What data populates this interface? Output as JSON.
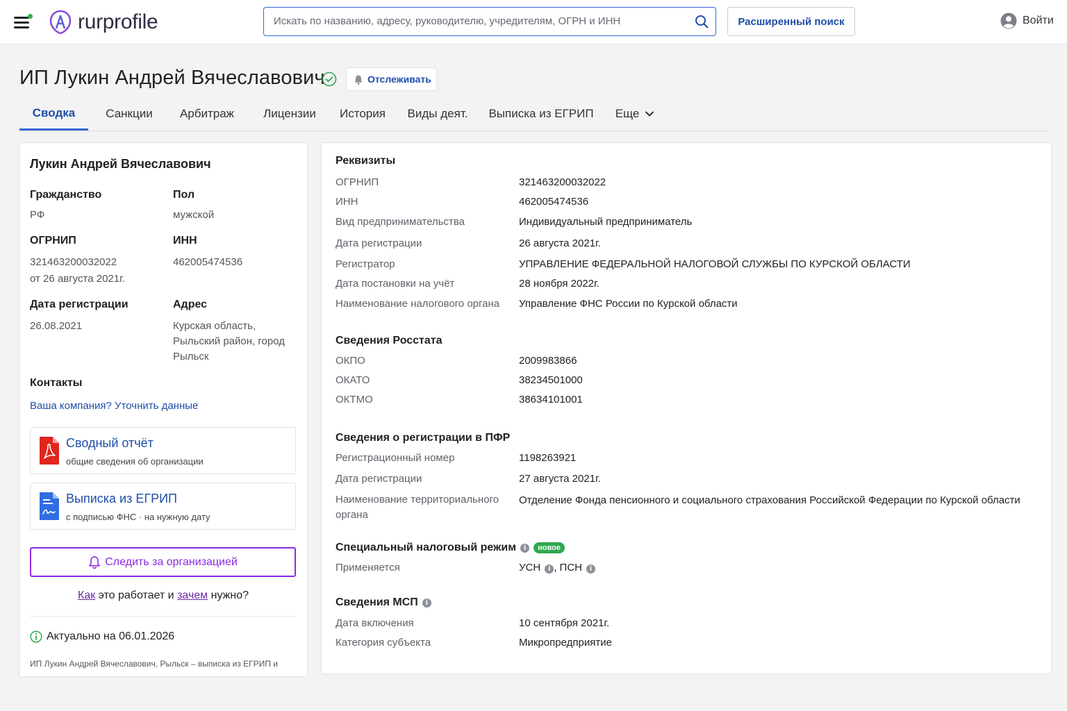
{
  "header": {
    "logo_text": "rurprofile",
    "search_placeholder": "Искать по названию, адресу, руководителю, учредителям, ОГРН и ИНН",
    "advanced_search": "Расширенный поиск",
    "login": "Войти"
  },
  "title": {
    "name": "ИП Лукин Андрей Вячеславович",
    "follow": "Отслеживать"
  },
  "tabs": [
    {
      "label": "Сводка",
      "active": true
    },
    {
      "label": "Санкции"
    },
    {
      "label": "Арбитраж"
    },
    {
      "label": "Лицензии"
    },
    {
      "label": "История"
    },
    {
      "label": "Виды деят."
    },
    {
      "label": "Выписка из ЕГРИП"
    },
    {
      "label": "Еще"
    }
  ],
  "summary": {
    "person_name": "Лукин Андрей Вячеславович",
    "citizenship_label": "Гражданство",
    "citizenship_value": "РФ",
    "sex_label": "Пол",
    "sex_value": "мужской",
    "ogrnip_label": "ОГРНИП",
    "ogrnip_value": "321463200032022",
    "ogrnip_date": "от 26 августа 2021г.",
    "inn_label": "ИНН",
    "inn_value": "462005474536",
    "reg_date_label": "Дата регистрации",
    "reg_date_value": "26.08.2021",
    "address_label": "Адрес",
    "address_value": [
      "Курская область,",
      "Рыльский район, город",
      "Рыльск"
    ],
    "contacts_label": "Контакты",
    "contacts_link": "Ваша компания? Уточнить данные",
    "doc1_title": "Сводный отчёт",
    "doc1_sub": "общие сведения об организации",
    "doc2_title": "Выписка из ЕГРИП",
    "doc2_sub": "с подписью ФНС · на нужную дату",
    "watch_button": "Следить за организацией",
    "how_link": "Как",
    "how_mid": " это работает и ",
    "how_link2": "зачем",
    "how_end": " нужно?",
    "actual": "Актуально на 06.01.2026",
    "foot_note": "ИП Лукин Андрей Вячеславович, Рыльск – выписка из ЕГРИП и"
  },
  "details": {
    "requisites_title": "Реквизиты",
    "requisites": [
      {
        "k": "ОГРНИП",
        "v": "321463200032022"
      },
      {
        "k": "ИНН",
        "v": "462005474536"
      },
      {
        "k": "Вид предпринимательства",
        "v": "Индивидуальный предприниматель"
      },
      {
        "k": "Дата регистрации",
        "v": "26 августа 2021г."
      },
      {
        "k": "Регистратор",
        "v": "УПРАВЛЕНИЕ ФЕДЕРАЛЬНОЙ НАЛОГОВОЙ СЛУЖБЫ ПО КУРСКОЙ ОБЛАСТИ"
      },
      {
        "k": "Дата постановки на учёт",
        "v": "28 ноября 2022г."
      },
      {
        "k": "Наименование налогового органа",
        "v": "Управление ФНС России по Курской области"
      }
    ],
    "rosstat_title": "Сведения Росстата",
    "rosstat": [
      {
        "k": "ОКПО",
        "v": "2009983866"
      },
      {
        "k": "ОКАТО",
        "v": "38234501000"
      },
      {
        "k": "ОКТМО",
        "v": "38634101001"
      }
    ],
    "pfr_title": "Сведения о регистрации в ПФР",
    "pfr": [
      {
        "k": "Регистрационный номер",
        "v": "1198263921"
      },
      {
        "k": "Дата регистрации",
        "v": "27 августа 2021г."
      },
      {
        "k": "Наименование территориального органа",
        "v": "Отделение Фонда пенсионного и социального страхования Российской Федерации по Курской области"
      }
    ],
    "tax_title": "Специальный налоговый режим",
    "tax_badge": "новое",
    "tax_applied_label": "Применяется",
    "tax_usn": "УСН",
    "tax_sep": ", ",
    "tax_psn": "ПСН",
    "msp_title": "Сведения МСП",
    "msp": [
      {
        "k": "Дата включения",
        "v": "10 сентября 2021г."
      },
      {
        "k": "Категория субъекта",
        "v": "Микропредприятие"
      }
    ],
    "info_glyph": "i"
  },
  "colors": {
    "accent": "#1f4ea8",
    "purple": "#8a2be2",
    "green": "#2fa84f"
  }
}
